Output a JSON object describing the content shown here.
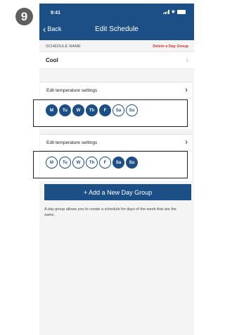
{
  "step": "9",
  "status": {
    "time": "9:41"
  },
  "header": {
    "back_label": "Back",
    "title": "Edit Schedule"
  },
  "schedule": {
    "section_label": "SCHEDULE NAME",
    "delete_label": "Delete a Day Group",
    "name": "Cool"
  },
  "groups": [
    {
      "title": "Edit temperature settings",
      "days": [
        {
          "label": "M",
          "selected": true
        },
        {
          "label": "Tu",
          "selected": true
        },
        {
          "label": "W",
          "selected": true
        },
        {
          "label": "Th",
          "selected": true
        },
        {
          "label": "F",
          "selected": true
        },
        {
          "label": "Sa",
          "selected": false
        },
        {
          "label": "Su",
          "selected": false
        }
      ]
    },
    {
      "title": "Edit temperature settings",
      "days": [
        {
          "label": "M",
          "selected": false
        },
        {
          "label": "Tu",
          "selected": false
        },
        {
          "label": "W",
          "selected": false
        },
        {
          "label": "Th",
          "selected": false
        },
        {
          "label": "F",
          "selected": false
        },
        {
          "label": "Sa",
          "selected": true
        },
        {
          "label": "Su",
          "selected": true
        }
      ]
    }
  ],
  "add_button_label": "+ Add a New Day Group",
  "help_text": "A day group allows you to create a schedule for days of the week that are the same.",
  "colors": {
    "header": "#1b4f86",
    "delete": "#d9322e",
    "accent": "#1b4f86"
  }
}
